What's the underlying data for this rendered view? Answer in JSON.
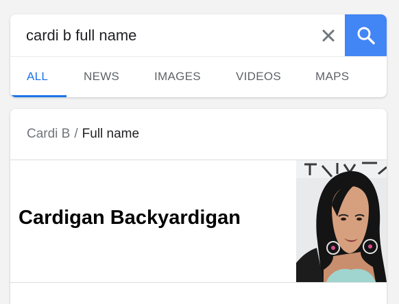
{
  "search": {
    "query": "cardi b full name",
    "clear_icon": "close-icon",
    "search_icon": "search-icon",
    "accent_color": "#4285f4"
  },
  "tabs": [
    {
      "label": "ALL",
      "active": true
    },
    {
      "label": "NEWS",
      "active": false
    },
    {
      "label": "IMAGES",
      "active": false
    },
    {
      "label": "VIDEOS",
      "active": false
    },
    {
      "label": "MAPS",
      "active": false
    }
  ],
  "result": {
    "breadcrumb": {
      "entity": "Cardi B",
      "separator": "/",
      "attribute": "Full name"
    },
    "answer": "Cardigan Backyardigan",
    "image_icon": "person-photo"
  }
}
